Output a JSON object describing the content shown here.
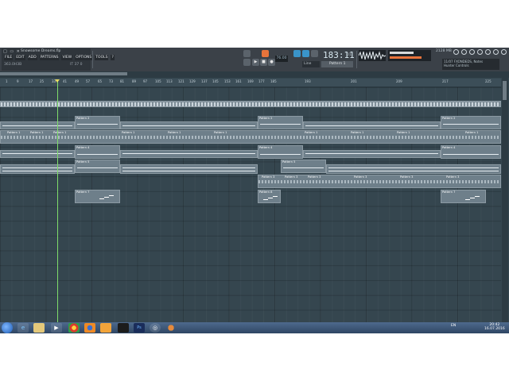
{
  "window": {
    "title": "Snowsome Dreams.flp",
    "controls": "□ ▭ ✕"
  },
  "menu": {
    "items": [
      "FILE",
      "EDIT",
      "ADD",
      "PATTERNS",
      "VIEW",
      "OPTIONS",
      "TOOLS",
      "?"
    ]
  },
  "hint_bar": {
    "left": "363.0H3B",
    "right": "IT 37  0"
  },
  "transport": {
    "tempo": "76.00",
    "time": "183:11",
    "time_sub": "01",
    "pattern": "Pattern 1",
    "line": "Line"
  },
  "status": {
    "cpu": "2128 MB",
    "hint_line1": "11/07 FXONDEDS, Notes",
    "hint_line2": "Hunter Controls"
  },
  "ruler_ticks": [
    "1",
    "9",
    "17",
    "25",
    "33",
    "41",
    "49",
    "57",
    "65",
    "73",
    "81",
    "89",
    "97",
    "105",
    "113",
    "121",
    "129",
    "137",
    "145",
    "153",
    "161",
    "169",
    "177",
    "185",
    "193",
    "201",
    "209",
    "217",
    "225"
  ],
  "clips": [
    {
      "label": "Pattern 1"
    },
    {
      "label": "Pattern 2"
    },
    {
      "label": "Pattern 3"
    },
    {
      "label": "Pattern 4"
    },
    {
      "label": "Pattern 5"
    },
    {
      "label": "Pattern 6"
    },
    {
      "label": "Pattern 7"
    },
    {
      "label": "Pattern 8"
    }
  ],
  "taskbar": {
    "apps": [
      "ie-icon",
      "explorer-icon",
      "media-icon",
      "chrome-icon",
      "firefox-icon",
      "fl-studio-icon",
      "terminal-icon",
      "photoshop-icon",
      "steam-icon",
      "app-icon"
    ],
    "language": "EN",
    "time": "20:42",
    "date": "16.07.2016"
  },
  "colors": {
    "accent_orange": "#e8743b",
    "accent_blue": "#3a94c9",
    "playhead": "#7edc6b"
  }
}
